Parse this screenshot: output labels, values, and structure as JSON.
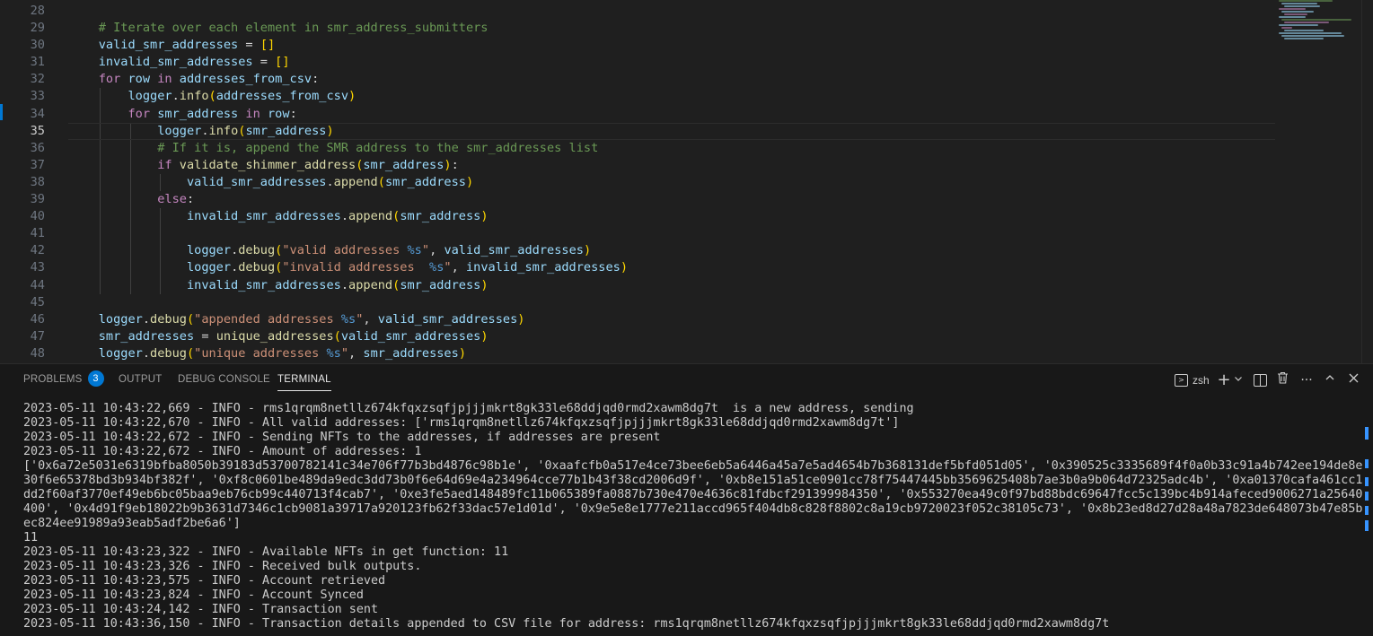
{
  "editor": {
    "active_line": "35",
    "lines": [
      {
        "n": "28",
        "tokens": []
      },
      {
        "n": "29",
        "tokens": [
          [
            "cm",
            "    # Iterate over each element in smr_address_submitters"
          ]
        ]
      },
      {
        "n": "30",
        "tokens": [
          [
            "vr",
            "    valid_smr_addresses"
          ],
          [
            "pl",
            " = "
          ],
          [
            "br",
            "[]"
          ]
        ]
      },
      {
        "n": "31",
        "tokens": [
          [
            "vr",
            "    invalid_smr_addresses"
          ],
          [
            "pl",
            " = "
          ],
          [
            "br",
            "[]"
          ]
        ]
      },
      {
        "n": "32",
        "tokens": [
          [
            "kw",
            "    for"
          ],
          [
            "vr",
            " row"
          ],
          [
            "kw",
            " in"
          ],
          [
            "vr",
            " addresses_from_csv"
          ],
          [
            "pl",
            ":"
          ]
        ]
      },
      {
        "n": "33",
        "tokens": [
          [
            "vr",
            "        logger"
          ],
          [
            "pl",
            "."
          ],
          [
            "fn",
            "info"
          ],
          [
            "br",
            "("
          ],
          [
            "vr",
            "addresses_from_csv"
          ],
          [
            "br",
            ")"
          ]
        ]
      },
      {
        "n": "34",
        "tokens": [
          [
            "kw",
            "        for"
          ],
          [
            "vr",
            " smr_address"
          ],
          [
            "kw",
            " in"
          ],
          [
            "vr",
            " row"
          ],
          [
            "pl",
            ":"
          ]
        ]
      },
      {
        "n": "35",
        "tokens": [
          [
            "vr",
            "            logger"
          ],
          [
            "pl",
            "."
          ],
          [
            "fn",
            "info"
          ],
          [
            "br",
            "("
          ],
          [
            "vr",
            "smr_address"
          ],
          [
            "br",
            ")"
          ]
        ]
      },
      {
        "n": "36",
        "tokens": [
          [
            "cm",
            "            # If it is, append the SMR address to the smr_addresses list"
          ]
        ]
      },
      {
        "n": "37",
        "tokens": [
          [
            "kw",
            "            if"
          ],
          [
            "fn",
            " validate_shimmer_address"
          ],
          [
            "br",
            "("
          ],
          [
            "vr",
            "smr_address"
          ],
          [
            "br",
            ")"
          ],
          [
            "pl",
            ":"
          ]
        ]
      },
      {
        "n": "38",
        "tokens": [
          [
            "vr",
            "                valid_smr_addresses"
          ],
          [
            "pl",
            "."
          ],
          [
            "fn",
            "append"
          ],
          [
            "br",
            "("
          ],
          [
            "vr",
            "smr_address"
          ],
          [
            "br",
            ")"
          ]
        ]
      },
      {
        "n": "39",
        "tokens": [
          [
            "kw",
            "            else"
          ],
          [
            "pl",
            ":"
          ]
        ]
      },
      {
        "n": "40",
        "tokens": [
          [
            "vr",
            "                invalid_smr_addresses"
          ],
          [
            "pl",
            "."
          ],
          [
            "fn",
            "append"
          ],
          [
            "br",
            "("
          ],
          [
            "vr",
            "smr_address"
          ],
          [
            "br",
            ")"
          ]
        ]
      },
      {
        "n": "41",
        "tokens": []
      },
      {
        "n": "42",
        "tokens": [
          [
            "vr",
            "                logger"
          ],
          [
            "pl",
            "."
          ],
          [
            "fn",
            "debug"
          ],
          [
            "br",
            "("
          ],
          [
            "st",
            "\"valid addresses "
          ],
          [
            "fm",
            "%s"
          ],
          [
            "st",
            "\""
          ],
          [
            "pl",
            ", "
          ],
          [
            "vr",
            "valid_smr_addresses"
          ],
          [
            "br",
            ")"
          ]
        ]
      },
      {
        "n": "43",
        "tokens": [
          [
            "vr",
            "                logger"
          ],
          [
            "pl",
            "."
          ],
          [
            "fn",
            "debug"
          ],
          [
            "br",
            "("
          ],
          [
            "st",
            "\"invalid addresses  "
          ],
          [
            "fm",
            "%s"
          ],
          [
            "st",
            "\""
          ],
          [
            "pl",
            ", "
          ],
          [
            "vr",
            "invalid_smr_addresses"
          ],
          [
            "br",
            ")"
          ]
        ]
      },
      {
        "n": "44",
        "tokens": [
          [
            "vr",
            "                invalid_smr_addresses"
          ],
          [
            "pl",
            "."
          ],
          [
            "fn",
            "append"
          ],
          [
            "br",
            "("
          ],
          [
            "vr",
            "smr_address"
          ],
          [
            "br",
            ")"
          ]
        ]
      },
      {
        "n": "45",
        "tokens": []
      },
      {
        "n": "46",
        "tokens": [
          [
            "vr",
            "    logger"
          ],
          [
            "pl",
            "."
          ],
          [
            "fn",
            "debug"
          ],
          [
            "br",
            "("
          ],
          [
            "st",
            "\"appended addresses "
          ],
          [
            "fm",
            "%s"
          ],
          [
            "st",
            "\""
          ],
          [
            "pl",
            ", "
          ],
          [
            "vr",
            "valid_smr_addresses"
          ],
          [
            "br",
            ")"
          ]
        ]
      },
      {
        "n": "47",
        "tokens": [
          [
            "vr",
            "    smr_addresses"
          ],
          [
            "pl",
            " = "
          ],
          [
            "fn",
            "unique_addresses"
          ],
          [
            "br",
            "("
          ],
          [
            "vr",
            "valid_smr_addresses"
          ],
          [
            "br",
            ")"
          ]
        ]
      },
      {
        "n": "48",
        "tokens": [
          [
            "vr",
            "    logger"
          ],
          [
            "pl",
            "."
          ],
          [
            "fn",
            "debug"
          ],
          [
            "br",
            "("
          ],
          [
            "st",
            "\"unique addresses "
          ],
          [
            "fm",
            "%s"
          ],
          [
            "st",
            "\""
          ],
          [
            "pl",
            ", "
          ],
          [
            "vr",
            "smr_addresses"
          ],
          [
            "br",
            ")"
          ]
        ]
      }
    ]
  },
  "panel": {
    "tabs": {
      "problems": "PROBLEMS",
      "problems_count": "3",
      "output": "OUTPUT",
      "debug_console": "DEBUG CONSOLE",
      "terminal": "TERMINAL"
    },
    "toolbar": {
      "shell": "zsh"
    },
    "terminal_lines": [
      "2023-05-11 10:43:22,669 - INFO - rms1qrqm8netllz674kfqxzsqfjpjjjmkrt8gk33le68ddjqd0rmd2xawm8dg7t  is a new address, sending",
      "2023-05-11 10:43:22,670 - INFO - All valid addresses: ['rms1qrqm8netllz674kfqxzsqfjpjjjmkrt8gk33le68ddjqd0rmd2xawm8dg7t']",
      "2023-05-11 10:43:22,672 - INFO - Sending NFTs to the addresses, if addresses are present",
      "2023-05-11 10:43:22,672 - INFO - Amount of addresses: 1",
      "['0x6a72e5031e6319bfba8050b39183d53700782141c34e706f77b3bd4876c98b1e', '0xaafcfb0a517e4ce73bee6eb5a6446a45a7e5ad4654b7b368131def5bfd051d05', '0x390525c3335689f4f0a0b33c91a4b742ee194de8e",
      "30f6e65378bd3b934bf382f', '0xf8c0601be489da9edc3dd73b0f6e64d69e4a234964cce77b1b43f38cd2006d9f', '0xb8e151a51ce0901cc78f75447445bb3569625408b7ae3b0a9b064d72325adc4b', '0xa01370cafa461cc1",
      "dd2f60af3770ef49eb6bc05baa9eb76cb99c440713f4cab7', '0xe3fe5aed148489fc11b065389fa0887b730e470e4636c81fdbcf291399984350', '0x553270ea49c0f97bd88bdc69647fcc5c139bc4b914afeced9006271a25640",
      "400', '0x4d91f9eb18022b9b3631d7346c1cb9081a39717a920123fb62f33dac57e1d01d', '0x9e5e8e1777e211accd965f404db8c828f8802c8a19cb9720023f052c38105c73', '0x8b23ed8d27d28a48a7823de648073b47e85b",
      "ec824ee91989a93eab5adf2be6a6']",
      "11",
      "2023-05-11 10:43:23,322 - INFO - Available NFTs in get function: 11",
      "2023-05-11 10:43:23,326 - INFO - Received bulk outputs.",
      "2023-05-11 10:43:23,575 - INFO - Account retrieved",
      "2023-05-11 10:43:23,824 - INFO - Account Synced",
      "2023-05-11 10:43:24,142 - INFO - Transaction sent",
      "2023-05-11 10:43:36,150 - INFO - Transaction details appended to CSV file for address: rms1qrqm8netllz674kfqxzsqfjpjjjmkrt8gk33le68ddjqd0rmd2xawm8dg7t"
    ]
  },
  "colors": {
    "accent": "#0078d4",
    "editor_bg": "#1f1f1f",
    "panel_bg": "#181818"
  },
  "icons": {
    "terminal_profile": "terminal-icon",
    "new_terminal": "plus-icon",
    "dropdown": "chevron-down-icon",
    "split": "split-editor-icon",
    "kill": "trash-icon",
    "more": "ellipsis-icon",
    "maximize": "chevron-up-icon",
    "close": "close-icon"
  }
}
